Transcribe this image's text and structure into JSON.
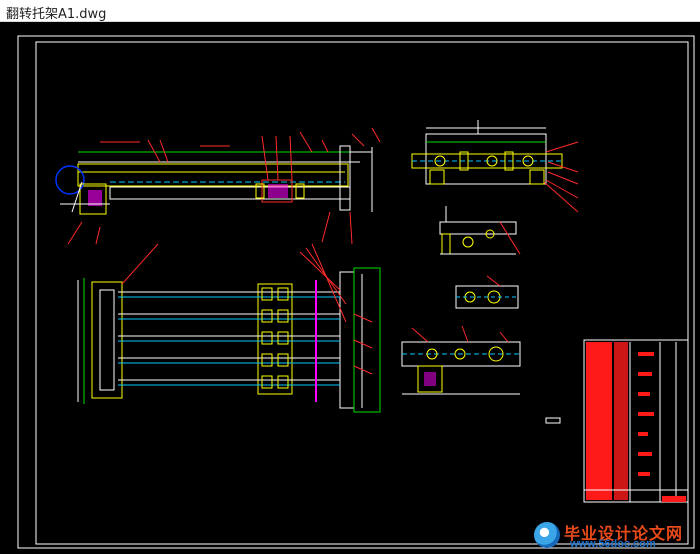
{
  "window": {
    "title": "翻转托架A1.dwg"
  },
  "drawing": {
    "colors": {
      "frame": "#ffffff",
      "main": "#ffff00",
      "secondary": "#ffffff",
      "dimension": "#ff2a2a",
      "centerline": "#00c8ff",
      "highlight": "#ff00ff",
      "green": "#00dd00"
    }
  },
  "watermark": {
    "title": "毕业设计论文网",
    "url": "www.56doc.com"
  }
}
